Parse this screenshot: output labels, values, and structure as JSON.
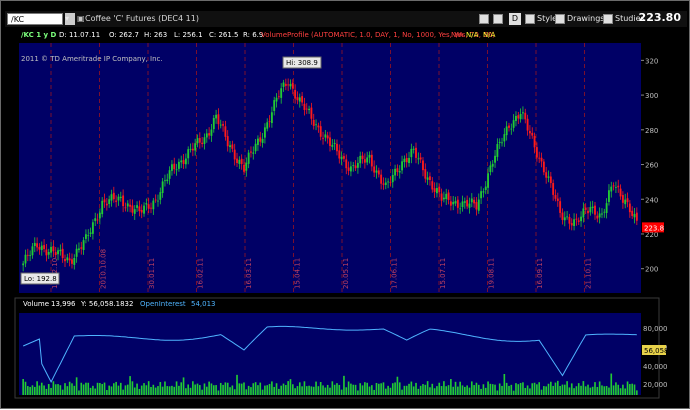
{
  "toolbar": {
    "symbol": "/KC",
    "instrument_desc": "Coffee 'C' Futures (DEC4 11)",
    "style_label": "Style",
    "drawings_label": "Drawings",
    "studies_label": "Studies",
    "d_label": "D",
    "last_price": "223.80"
  },
  "info_bar": {
    "symbol_tag": "/KC 1 y D",
    "date": "D: 11.07.11",
    "open": "O: 262.7",
    "high": "H: 263",
    "low": "L: 256.1",
    "close": "C: 261.5",
    "range": "R: 6.9",
    "study": "VolumeProfile (AUTOMATIC, 1.0, DAY, 1, No, 1000, Yes, Yes, 70, 50)",
    "na1": "N/A",
    "na2": "N/A",
    "na3": "N/A"
  },
  "copyright": "2011 © TD Ameritrade IP Company, Inc.",
  "volume_bar": {
    "volume_label": "Volume",
    "volume_value": "13,996",
    "y_label": "Y: 56,058.1832",
    "oi_label": "OpenInterest",
    "oi_value": "54,013"
  },
  "colors": {
    "background": "#000066",
    "up": "#22cc33",
    "down": "#ff1a1a",
    "grid": "#7a0f2e",
    "oi_line": "#4fb4ff",
    "volume": "#22cc33",
    "last_marker": "#ff0000"
  },
  "chart_data": [
    {
      "type": "candlestick",
      "ylim": [
        186,
        330
      ],
      "y_ticks": [
        200,
        220,
        240,
        260,
        280,
        300,
        320
      ],
      "annotations": {
        "high_label": "Hi: 308.9",
        "high_value": 308.9,
        "low_label": "Lo: 192.8",
        "low_value": 192.8,
        "last_price": "223.8",
        "last_value": 223.8
      },
      "x_dates": [
        "17.12.10",
        "2010.10.08",
        "30.01.11",
        "16.02.11",
        "16.03.11",
        "15.04.11",
        "20.05.11",
        "17.06.11",
        "15.07.11",
        "19.08.11",
        "16.09.11",
        "21.10.11"
      ],
      "price_path": [
        [
          0,
          203
        ],
        [
          6,
          214
        ],
        [
          12,
          210
        ],
        [
          20,
          205
        ],
        [
          27,
          216
        ],
        [
          34,
          238
        ],
        [
          42,
          240
        ],
        [
          50,
          232
        ],
        [
          57,
          240
        ],
        [
          64,
          257
        ],
        [
          72,
          268
        ],
        [
          78,
          275
        ],
        [
          83,
          288
        ],
        [
          88,
          272
        ],
        [
          95,
          258
        ],
        [
          103,
          278
        ],
        [
          110,
          300
        ],
        [
          114,
          308.9
        ],
        [
          119,
          296
        ],
        [
          126,
          283
        ],
        [
          133,
          270
        ],
        [
          141,
          258
        ],
        [
          149,
          264
        ],
        [
          156,
          246
        ],
        [
          163,
          262
        ],
        [
          168,
          267
        ],
        [
          173,
          255
        ],
        [
          180,
          240
        ],
        [
          187,
          238
        ],
        [
          195,
          236
        ],
        [
          202,
          262
        ],
        [
          209,
          283
        ],
        [
          214,
          290
        ],
        [
          219,
          274
        ],
        [
          224,
          258
        ],
        [
          231,
          232
        ],
        [
          238,
          226
        ],
        [
          244,
          236
        ],
        [
          249,
          230
        ],
        [
          254,
          249
        ],
        [
          259,
          240
        ],
        [
          264,
          225
        ]
      ]
    },
    {
      "type": "bar",
      "series_name": "Volume",
      "y_ticks": [
        "80,000",
        "60,000",
        "40,000",
        "20,000"
      ],
      "oi_marker": "56,058"
    }
  ]
}
